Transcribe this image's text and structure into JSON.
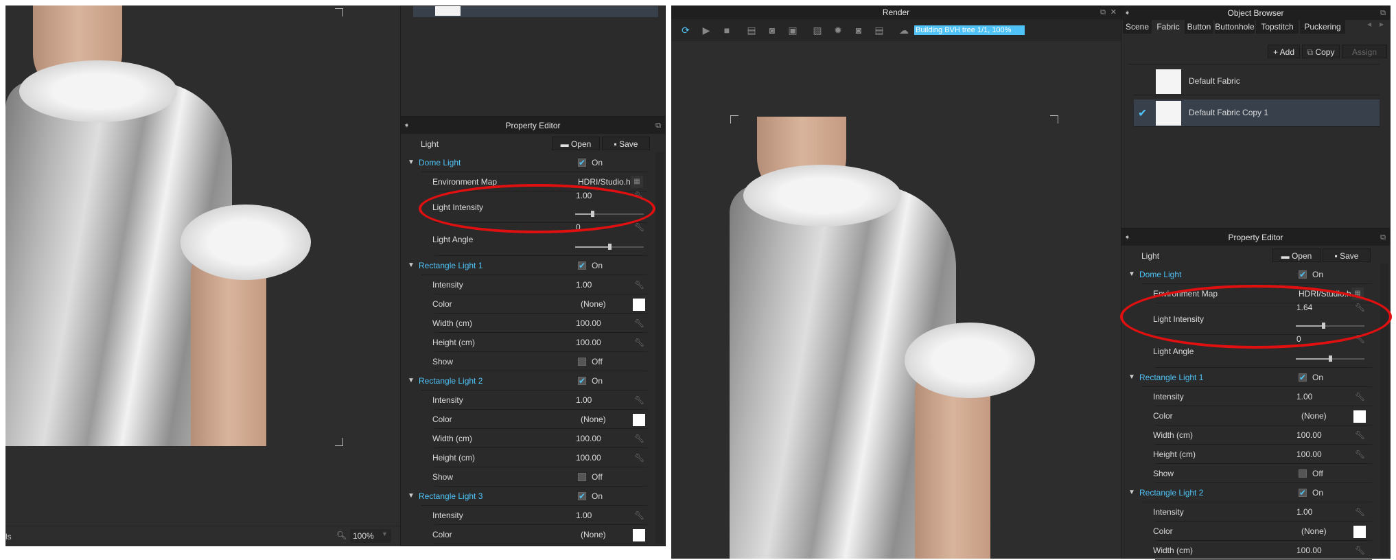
{
  "left": {
    "status_text": "ls",
    "zoom_value": "100%",
    "property_editor": {
      "title": "Property Editor",
      "light_label": "Light",
      "open_label": "Open",
      "save_label": "Save",
      "rows": [
        {
          "type": "group",
          "label": "Dome Light",
          "check": true,
          "check_label": "On"
        },
        {
          "type": "map",
          "label": "Environment Map",
          "value": "HDRI/Studio.hdr"
        },
        {
          "type": "slider",
          "label": "Light Intensity",
          "value": "1.00",
          "fraction": 0.25
        },
        {
          "type": "slider",
          "label": "Light Angle",
          "value": "0",
          "fraction": 0.5
        },
        {
          "type": "group",
          "label": "Rectangle Light 1",
          "check": true,
          "check_label": "On"
        },
        {
          "type": "num",
          "label": "Intensity",
          "value": "1.00"
        },
        {
          "type": "color",
          "label": "Color",
          "value": "(None)"
        },
        {
          "type": "num",
          "label": "Width (cm)",
          "value": "100.00"
        },
        {
          "type": "num",
          "label": "Height (cm)",
          "value": "100.00"
        },
        {
          "type": "check",
          "label": "Show",
          "check": false,
          "check_label": "Off"
        },
        {
          "type": "group",
          "label": "Rectangle Light 2",
          "check": true,
          "check_label": "On"
        },
        {
          "type": "num",
          "label": "Intensity",
          "value": "1.00"
        },
        {
          "type": "color",
          "label": "Color",
          "value": "(None)"
        },
        {
          "type": "num",
          "label": "Width (cm)",
          "value": "100.00"
        },
        {
          "type": "num",
          "label": "Height (cm)",
          "value": "100.00"
        },
        {
          "type": "check",
          "label": "Show",
          "check": false,
          "check_label": "Off"
        },
        {
          "type": "group",
          "label": "Rectangle Light 3",
          "check": true,
          "check_label": "On"
        },
        {
          "type": "num",
          "label": "Intensity",
          "value": "1.00"
        },
        {
          "type": "color",
          "label": "Color",
          "value": "(None)"
        }
      ]
    }
  },
  "right": {
    "render": {
      "title": "Render",
      "progress_text": "Building BVH tree 1/1, 100%",
      "progress_fraction": 1.0,
      "toolbar_icons": [
        "refresh-render-icon",
        "play-render-icon",
        "stop-render-icon",
        "document-icon",
        "camera-snapshot-icon",
        "open-image-icon",
        "image-settings-icon",
        "light-settings-icon",
        "camera-settings-icon",
        "render-settings-icon",
        "cloud-render-icon"
      ]
    },
    "object_browser": {
      "title": "Object Browser",
      "tabs": [
        "Scene",
        "Fabric",
        "Button",
        "Buttonhole",
        "Topstitch",
        "Puckering"
      ],
      "active_tab": 1,
      "add_label": "+ Add",
      "copy_label": "Copy",
      "assign_label": "Assign",
      "items": [
        "Default Fabric",
        "Default Fabric Copy 1"
      ],
      "selected_item": 1
    },
    "property_editor": {
      "title": "Property Editor",
      "light_label": "Light",
      "open_label": "Open",
      "save_label": "Save",
      "rows": [
        {
          "type": "group",
          "label": "Dome Light",
          "check": true,
          "check_label": "On"
        },
        {
          "type": "map",
          "label": "Environment Map",
          "value": "HDRI/Studio.hdr"
        },
        {
          "type": "slider",
          "label": "Light Intensity",
          "value": "1.64",
          "fraction": 0.4
        },
        {
          "type": "slider",
          "label": "Light Angle",
          "value": "0",
          "fraction": 0.5
        },
        {
          "type": "group",
          "label": "Rectangle Light 1",
          "check": true,
          "check_label": "On"
        },
        {
          "type": "num",
          "label": "Intensity",
          "value": "1.00"
        },
        {
          "type": "color",
          "label": "Color",
          "value": "(None)"
        },
        {
          "type": "num",
          "label": "Width (cm)",
          "value": "100.00"
        },
        {
          "type": "num",
          "label": "Height (cm)",
          "value": "100.00"
        },
        {
          "type": "check",
          "label": "Show",
          "check": false,
          "check_label": "Off"
        },
        {
          "type": "group",
          "label": "Rectangle Light 2",
          "check": true,
          "check_label": "On"
        },
        {
          "type": "num",
          "label": "Intensity",
          "value": "1.00"
        },
        {
          "type": "color",
          "label": "Color",
          "value": "(None)"
        },
        {
          "type": "num",
          "label": "Width (cm)",
          "value": "100.00"
        }
      ]
    }
  },
  "colors": {
    "accent": "#4fc3f7",
    "highlight": "#e01010",
    "selected_row": "#37404b"
  }
}
